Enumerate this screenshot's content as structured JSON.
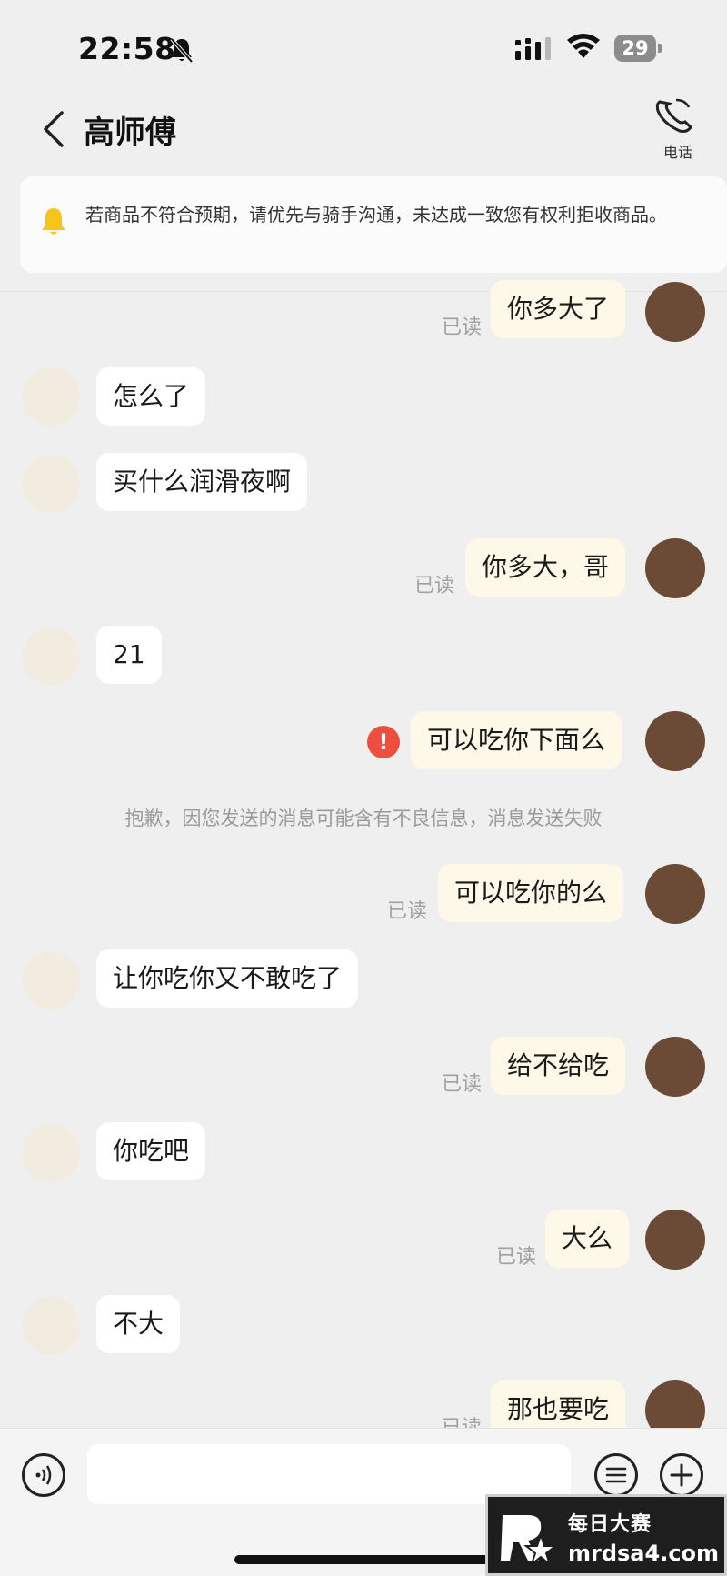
{
  "status_bar": {
    "time": "22:58",
    "battery": "29"
  },
  "header": {
    "title": "高师傅",
    "call_label": "电话"
  },
  "notice": {
    "text": "若商品不符合预期，请优先与骑手沟通，未达成一致您有权利拒收商品。"
  },
  "messages": [
    {
      "side": "out",
      "text": "你多大了",
      "status": "已读"
    },
    {
      "side": "in",
      "text": "怎么了"
    },
    {
      "side": "in",
      "text": "买什么润滑夜啊"
    },
    {
      "side": "out",
      "text": "你多大，哥",
      "status": "已读"
    },
    {
      "side": "in",
      "text": "21"
    },
    {
      "side": "out",
      "text": "可以吃你下面么",
      "failed": true
    },
    {
      "side": "system",
      "text": "抱歉，因您发送的消息可能含有不良信息，消息发送失败"
    },
    {
      "side": "out",
      "text": "可以吃你的么",
      "status": "已读"
    },
    {
      "side": "in",
      "text": "让你吃你又不敢吃了"
    },
    {
      "side": "out",
      "text": "给不给吃",
      "status": "已读"
    },
    {
      "side": "in",
      "text": "你吃吧"
    },
    {
      "side": "out",
      "text": "大么",
      "status": "已读"
    },
    {
      "side": "in",
      "text": "不大"
    },
    {
      "side": "out",
      "text": "那也要吃",
      "status": "已读"
    }
  ],
  "watermark": {
    "name": "每日大赛",
    "url": "mrdsa4.com"
  },
  "colors": {
    "fail": "#ec4f3f",
    "incoming_bubble": "#ffffff",
    "outgoing_bubble": "#fdf8e8",
    "background": "#efefef"
  }
}
